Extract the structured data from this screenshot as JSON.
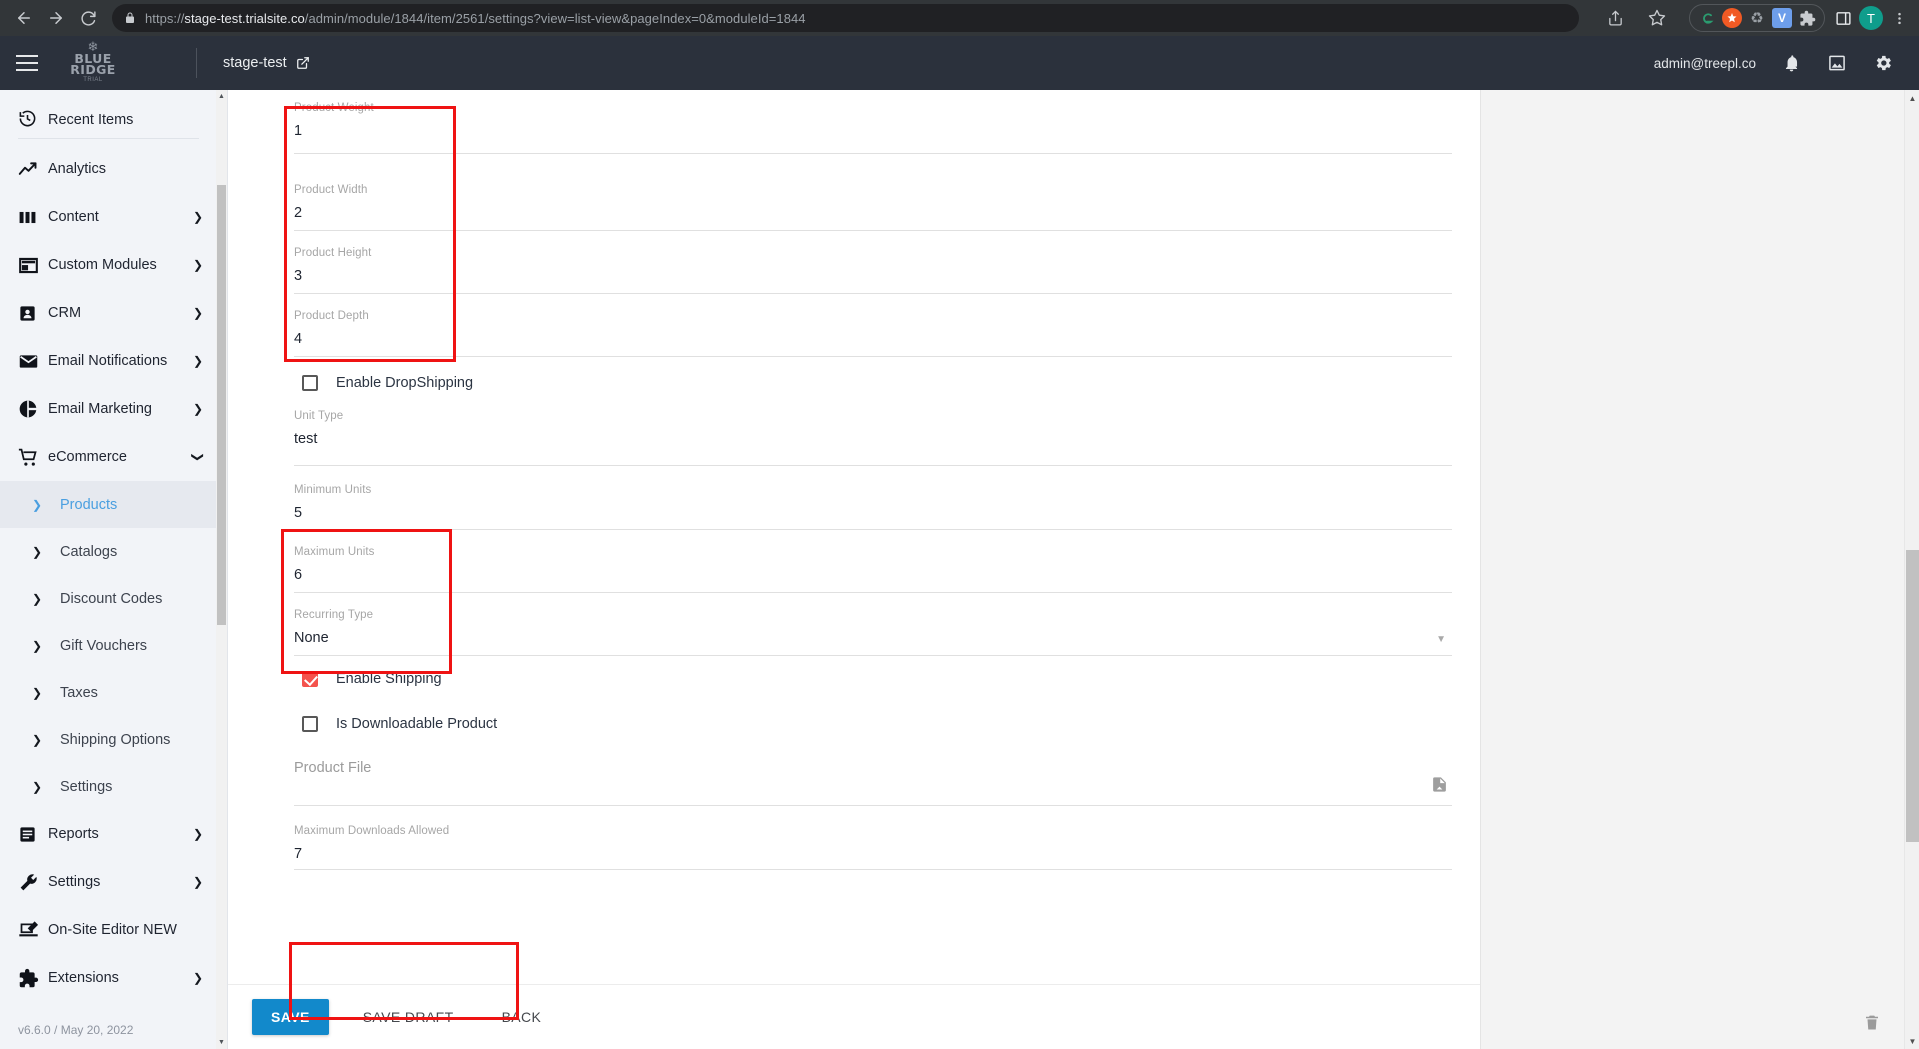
{
  "browser": {
    "url_prefix": "https://",
    "url_domain": "stage-test.trialsite.co",
    "url_path": "/admin/module/1844/item/2561/settings?view=list-view&pageIndex=0&moduleId=1844",
    "back_icon": "back-arrow-icon",
    "forward_icon": "forward-arrow-icon",
    "reload_icon": "reload-icon",
    "lock_icon": "lock-icon",
    "share_icon": "share-icon",
    "bookmark_icon": "star-icon",
    "extensions": [
      {
        "name": "evernote-extension-icon",
        "color": "#2b9c70",
        "glyph": "@"
      },
      {
        "name": "orange-extension-icon",
        "color": "#f15a24",
        "glyph": "⬤"
      },
      {
        "name": "recycle-extension-icon",
        "color": "#9aa0a6",
        "glyph": "♻"
      },
      {
        "name": "vidiq-extension-icon",
        "color": "#6d9eeb",
        "glyph": "V"
      },
      {
        "name": "puzzle-extensions-icon",
        "color": "#c8cbcf",
        "glyph": "❖"
      }
    ],
    "side_panel_icon": "side-panel-icon",
    "profile_initial": "T",
    "menu_icon": "kebab-menu-icon"
  },
  "header": {
    "menu_icon": "hamburger-menu-icon",
    "brand_snowflake": "❄",
    "brand_line1": "BLUE",
    "brand_line2": "RIDGE",
    "brand_line3": "TRIAL",
    "site_name": "stage-test",
    "site_external_icon": "external-link-icon",
    "user_email": "admin@treepl.co",
    "notification_icon": "bell-icon",
    "media_icon": "image-icon",
    "settings_icon": "gear-icon"
  },
  "sidebar": {
    "recent_label": "Recent Items",
    "recent_icon": "recent-clock-icon",
    "items": [
      {
        "label": "Analytics",
        "icon": "analytics-trend-icon",
        "caret": false
      },
      {
        "label": "Content",
        "icon": "content-columns-icon",
        "caret": true
      },
      {
        "label": "Custom Modules",
        "icon": "custom-modules-icon",
        "caret": true
      },
      {
        "label": "CRM",
        "icon": "crm-contact-icon",
        "caret": true
      },
      {
        "label": "Email Notifications",
        "icon": "envelope-icon",
        "caret": true
      },
      {
        "label": "Email Marketing",
        "icon": "pie-chart-icon",
        "caret": true
      },
      {
        "label": "eCommerce",
        "icon": "shopping-cart-icon",
        "caret": true,
        "expanded": true
      }
    ],
    "ecommerce_subitems": [
      {
        "label": "Products",
        "active": true
      },
      {
        "label": "Catalogs",
        "active": false
      },
      {
        "label": "Discount Codes",
        "active": false
      },
      {
        "label": "Gift Vouchers",
        "active": false
      },
      {
        "label": "Taxes",
        "active": false
      },
      {
        "label": "Shipping Options",
        "active": false
      },
      {
        "label": "Settings",
        "active": false
      }
    ],
    "items_after": [
      {
        "label": "Reports",
        "icon": "reports-doc-icon",
        "caret": true
      },
      {
        "label": "Settings",
        "icon": "wrench-icon",
        "caret": true
      },
      {
        "label": "On-Site Editor NEW",
        "icon": "onsite-editor-icon",
        "caret": false
      },
      {
        "label": "Extensions",
        "icon": "puzzle-icon",
        "caret": true
      }
    ],
    "version": "v6.6.0 / May 20, 2022"
  },
  "form": {
    "fields": [
      {
        "label": "Product Weight",
        "value": "1"
      },
      {
        "label": "Product Width",
        "value": "2"
      },
      {
        "label": "Product Height",
        "value": "3"
      },
      {
        "label": "Product Depth",
        "value": "4"
      }
    ],
    "enable_dropshipping": {
      "label": "Enable DropShipping",
      "checked": false
    },
    "unit_type": {
      "label": "Unit Type",
      "value": "test"
    },
    "units": [
      {
        "label": "Minimum Units",
        "value": "5"
      },
      {
        "label": "Maximum Units",
        "value": "6"
      }
    ],
    "recurring_type": {
      "label": "Recurring Type",
      "value": "None",
      "caret_icon": "chevron-down-icon"
    },
    "enable_shipping": {
      "label": "Enable Shipping",
      "checked": true
    },
    "is_downloadable": {
      "label": "Is Downloadable Product",
      "checked": false
    },
    "product_file": {
      "placeholder": "Product File",
      "upload_icon": "file-upload-icon"
    },
    "max_downloads": {
      "label": "Maximum Downloads Allowed",
      "value": "7"
    }
  },
  "actions": {
    "save": "SAVE",
    "save_draft": "SAVE DRAFT",
    "back": "BACK",
    "delete_icon": "trash-icon"
  },
  "colors": {
    "accent_blue": "#1289cb",
    "checkbox_red": "#f4534d",
    "annotation_red": "#ef1313",
    "active_link": "#4a9fe0",
    "header_bg": "#2b313c",
    "sidebar_bg": "#f2f4f8"
  }
}
